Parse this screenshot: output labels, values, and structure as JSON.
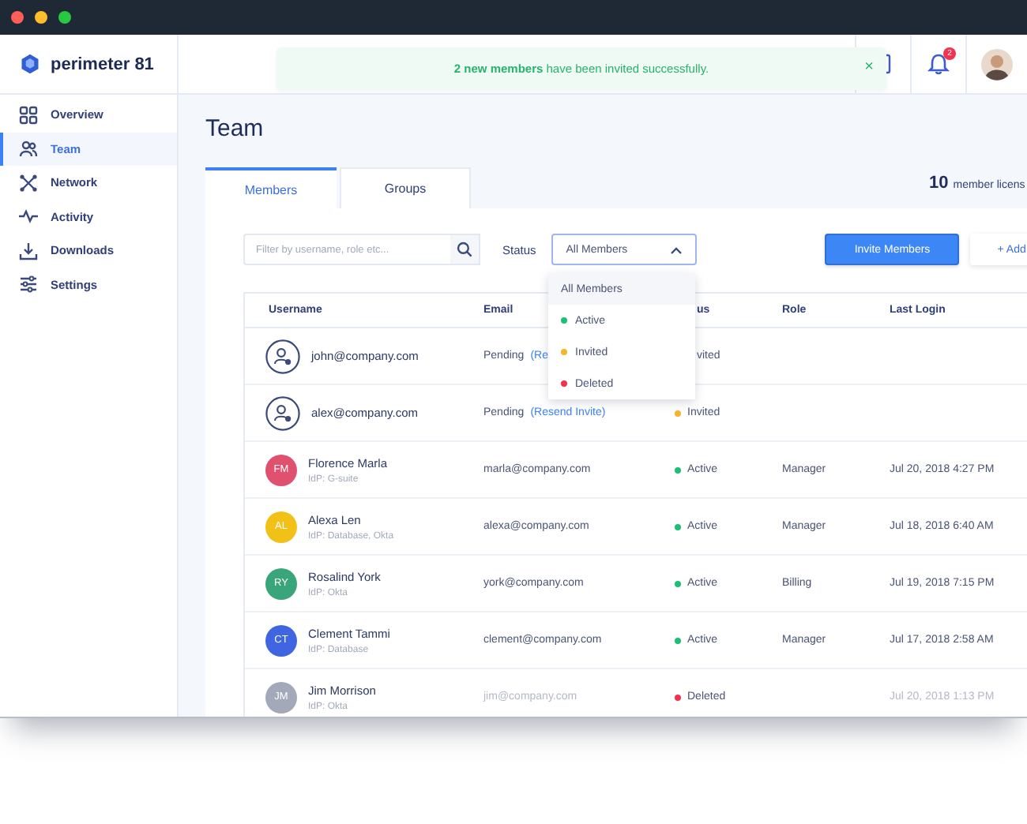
{
  "header": {
    "logo": "perimeter 81",
    "toast": {
      "message": "**2 new members** have been invited successfully.",
      "close": "×"
    },
    "notifications": {
      "count": "2"
    }
  },
  "sidebar": {
    "items": [
      {
        "label": "Overview",
        "selected": false
      },
      {
        "label": "Team",
        "selected": true
      },
      {
        "label": "Network",
        "selected": false
      },
      {
        "label": "Activity",
        "selected": false
      },
      {
        "label": "Downloads",
        "selected": false
      },
      {
        "label": "Settings",
        "selected": false
      }
    ]
  },
  "page_title": "Team",
  "tabs": [
    {
      "label": "Members",
      "selected": true
    },
    {
      "label": "Groups",
      "selected": false
    }
  ],
  "licenses": {
    "count": "10",
    "label": "member licens"
  },
  "filter": {
    "placeholder": "Filter by username, role etc..."
  },
  "status_filter": {
    "label": "Status",
    "value": "All Members",
    "expanded": true,
    "options": [
      {
        "label": "All Members",
        "selected": true
      },
      {
        "label": "Active",
        "selected": false,
        "color": "#1dbf73"
      },
      {
        "label": "Invited",
        "selected": false,
        "color": "#f7b32b"
      },
      {
        "label": "Deleted",
        "selected": false,
        "color": "#f0344f"
      }
    ]
  },
  "buttons": {
    "invite": "Invite Members",
    "add": "+ Add"
  },
  "table": {
    "columns": [
      "Username",
      "Email",
      "us",
      "Role",
      "Last Login"
    ],
    "rows": [
      {
        "kind": "pending",
        "username": "john@company.com",
        "email": "Pending",
        "email_link": "(Re",
        "status": {
          "label": "vited"
        }
      },
      {
        "kind": "pending",
        "username": "alex@company.com",
        "email": "Pending",
        "email_link": "(Resend Invite)",
        "status": {
          "label": "Invited",
          "color": "#f7b32b"
        }
      },
      {
        "kind": "member",
        "initials": "FM",
        "color": "#e0506f",
        "username": "Florence Marla",
        "idp": "IdP: G-suite",
        "email": "marla@company.com",
        "status": {
          "label": "Active",
          "color": "#1dbf73"
        },
        "role": "Manager",
        "last_login": "Jul 20, 2018 4:27 PM",
        "greyed": false
      },
      {
        "kind": "member",
        "initials": "AL",
        "color": "#f2c118",
        "username": "Alexa Len",
        "idp": "IdP: Database, Okta",
        "email": "alexa@company.com",
        "status": {
          "label": "Active",
          "color": "#1dbf73"
        },
        "role": "Manager",
        "last_login": "Jul 18, 2018 6:40 AM",
        "greyed": false
      },
      {
        "kind": "member",
        "initials": "RY",
        "color": "#3aa57a",
        "username": "Rosalind York",
        "idp": "IdP: Okta",
        "email": "york@company.com",
        "status": {
          "label": "Active",
          "color": "#1dbf73"
        },
        "role": "Billing",
        "last_login": "Jul 19, 2018 7:15 PM",
        "greyed": false
      },
      {
        "kind": "member",
        "initials": "CT",
        "color": "#3f66e0",
        "username": "Clement Tammi",
        "idp": "IdP: Database",
        "email": "clement@company.com",
        "status": {
          "label": "Active",
          "color": "#1dbf73"
        },
        "role": "Manager",
        "last_login": "Jul 17, 2018 2:58 AM",
        "greyed": false
      },
      {
        "kind": "member",
        "initials": "JM",
        "color": "#a3a9b8",
        "username": "Jim Morrison",
        "idp": "IdP: Okta",
        "email": "jim@company.com",
        "status": {
          "label": "Deleted",
          "color": "#f0344f"
        },
        "last_login": "Jul 20, 2018 1:13 PM",
        "greyed": true
      }
    ]
  }
}
